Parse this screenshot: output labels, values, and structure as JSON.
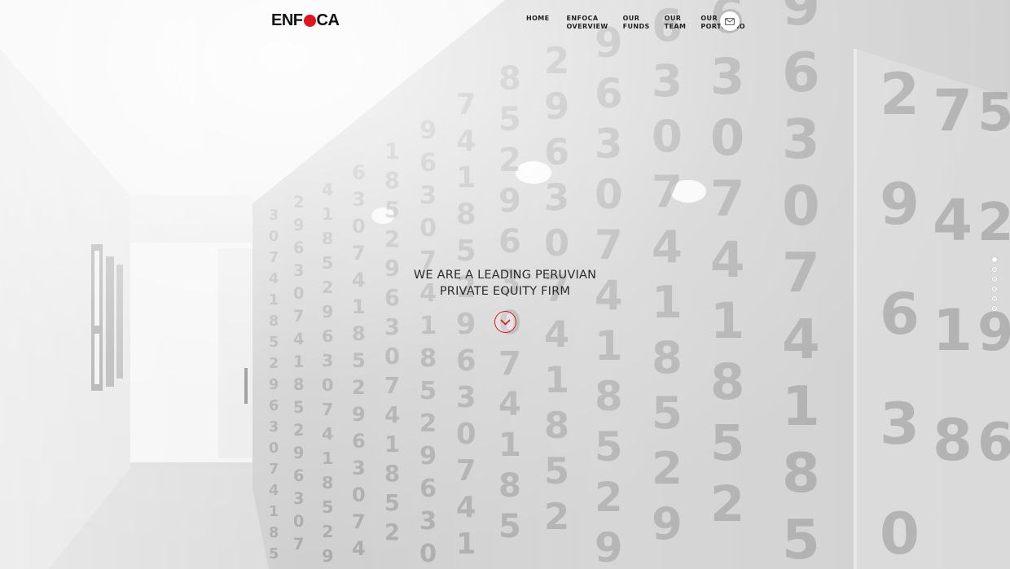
{
  "brand": {
    "logo_left": "ENF",
    "logo_right": "CA",
    "accent_color": "#e3141e"
  },
  "nav": {
    "items": [
      {
        "lines": [
          "HOME"
        ]
      },
      {
        "lines": [
          "ENFOCA",
          "OVERVIEW"
        ]
      },
      {
        "lines": [
          "OUR",
          "FUNDS"
        ]
      },
      {
        "lines": [
          "OUR",
          "TEAM"
        ]
      },
      {
        "lines": [
          "OUR",
          "PORTFOLIO"
        ]
      }
    ],
    "contact_icon": "envelope-icon"
  },
  "hero": {
    "line1": "WE ARE A LEADING PERUVIAN",
    "line2": "PRIVATE EQUITY FIRM",
    "scroll_icon": "chevron-down-icon"
  },
  "slider": {
    "count": 6,
    "active": 0
  }
}
